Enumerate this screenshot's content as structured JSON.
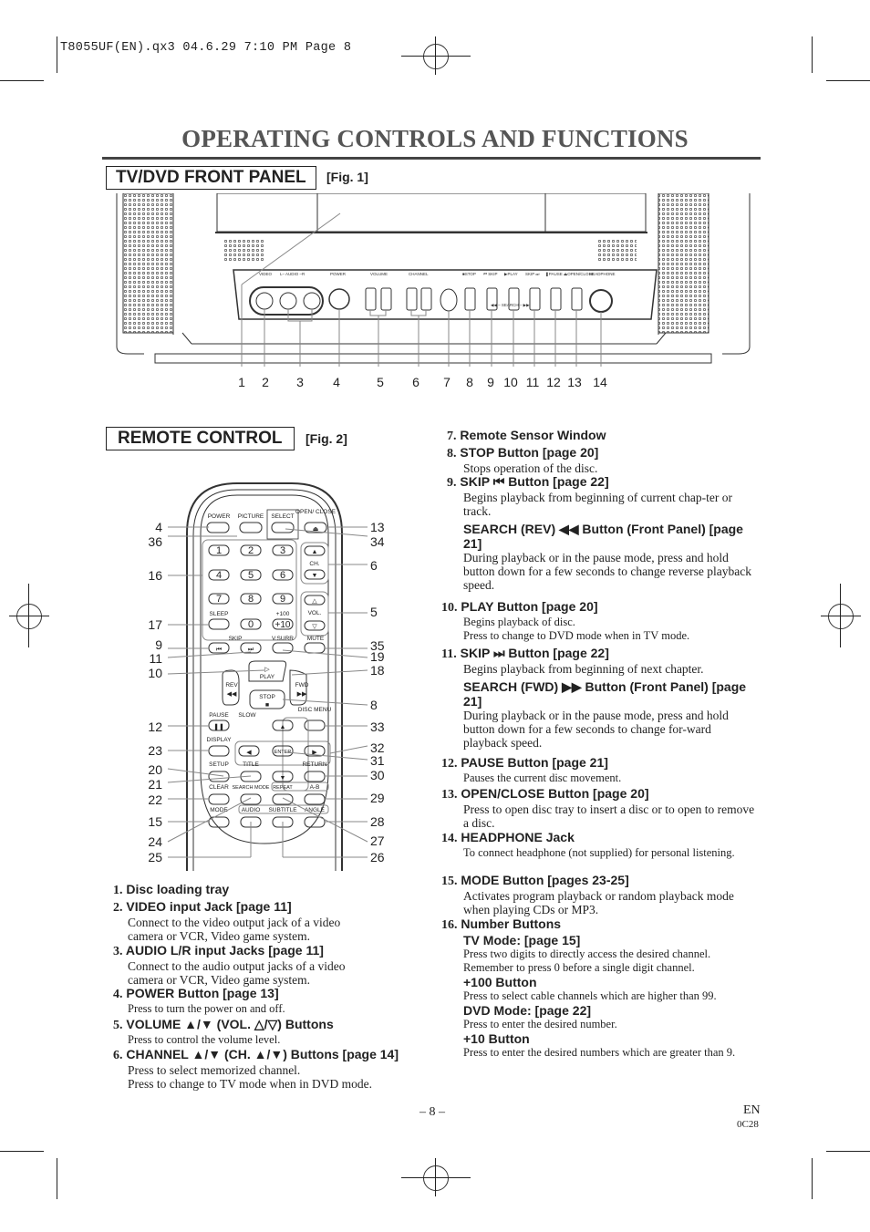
{
  "slug": "T8055UF(EN).qx3   04.6.29   7:10 PM   Page 8",
  "page_title": "OPERATING CONTROLS AND FUNCTIONS",
  "front_panel": {
    "heading": "TV/DVD FRONT PANEL",
    "fig": "[Fig. 1]",
    "labels": {
      "video": "VIDEO",
      "audio": "L– AUDIO –R",
      "power": "POWER",
      "volume": "VOLUME",
      "channel": "CHANNEL",
      "stop": "■STOP",
      "skip_rev": "⏮ SKIP",
      "play": "▶PLAY",
      "skip_fwd": "SKIP ⏭",
      "pause": "❚PAUSE",
      "open_close": "⏏OPEN/CLOSE",
      "headphone": "HEADPHONE",
      "search": "◀◀ – SEARCH – ▶▶"
    },
    "callouts": [
      "1",
      "2",
      "3",
      "4",
      "5",
      "6",
      "7",
      "8",
      "9",
      "10",
      "11",
      "12",
      "13",
      "14"
    ]
  },
  "remote": {
    "heading": "REMOTE CONTROL",
    "fig": "[Fig. 2]",
    "buttons": {
      "power": "POWER",
      "picture": "PICTURE",
      "select": "SELECT",
      "open_close": "OPEN/ CLOSE",
      "n1": "1",
      "n2": "2",
      "n3": "3",
      "n4": "4",
      "n5": "5",
      "n6": "6",
      "n7": "7",
      "n8": "8",
      "n9": "9",
      "n0": "0",
      "plus100": "+100",
      "plus10": "+10",
      "sleep": "SLEEP",
      "ch": "CH.",
      "vol": "VOL.",
      "skip": "SKIP",
      "vsurr": "V.SURR",
      "mute": "MUTE",
      "play": "PLAY",
      "rev": "REV",
      "fwd": "FWD",
      "stop": "STOP",
      "pause": "PAUSE",
      "slow": "SLOW",
      "disc_menu": "DISC MENU",
      "display": "DISPLAY",
      "enter": "ENTER",
      "setup": "SETUP",
      "title": "TITLE",
      "return": "RETURN",
      "clear": "CLEAR",
      "search_mode": "SEARCH MODE",
      "repeat": "REPEAT",
      "ab": "A-B",
      "mode": "MODE",
      "audio": "AUDIO",
      "subtitle": "SUBTITLE",
      "angle": "ANGLE"
    },
    "callouts_left": [
      "4",
      "36",
      "16",
      "17",
      "9",
      "11",
      "10",
      "12",
      "23",
      "20",
      "21",
      "22",
      "15",
      "24",
      "25"
    ],
    "callouts_right": [
      "13",
      "34",
      "6",
      "5",
      "35",
      "19",
      "18",
      "8",
      "33",
      "32",
      "31",
      "30",
      "29",
      "28",
      "27",
      "26"
    ]
  },
  "items_left": [
    {
      "num": "1.",
      "title": "Disc loading tray",
      "desc": []
    },
    {
      "num": "2.",
      "title": "VIDEO input Jack [page 11]",
      "desc": [
        "Connect to the video output jack of a video",
        "camera or VCR, Video game system."
      ]
    },
    {
      "num": "3.",
      "title": "AUDIO L/R input Jacks [page 11]",
      "desc": [
        "Connect to the audio output jacks of a video",
        "camera or VCR, Video game system."
      ]
    },
    {
      "num": "4.",
      "title": "POWER Button [page 13]",
      "desc": [
        "Press to turn the power on and off."
      ]
    },
    {
      "num": "5.",
      "title": "VOLUME ▲/▼ (VOL. △/▽) Buttons",
      "desc": [
        "Press to control the volume level."
      ]
    },
    {
      "num": "6.",
      "title": "CHANNEL ▲/▼ (CH. ▲/▼) Buttons [page 14]",
      "desc": [
        "Press to select memorized channel.",
        "Press to change to TV mode when in DVD mode."
      ]
    }
  ],
  "items_right": [
    {
      "num": "7.",
      "title": "Remote Sensor Window"
    },
    {
      "num": "8.",
      "title": "STOP Button [page 20]",
      "desc": "Stops operation of the disc."
    },
    {
      "num": "9.",
      "title": "SKIP ⏮ Button [page 22]",
      "desc": "Begins playback from beginning of current chap-ter or track.",
      "sub": "SEARCH (REV) ◀◀ Button (Front Panel) [page 21]",
      "subdesc": "During playback or in the pause mode, press and hold button down for a few seconds to change reverse playback speed."
    },
    {
      "num": "10.",
      "title": "PLAY Button [page 20]",
      "desc": "Begins playback of disc.",
      "desc2": "Press to change to DVD mode when in TV mode."
    },
    {
      "num": "11.",
      "title": "SKIP ⏭ Button [page 22]",
      "desc": "Begins playback from beginning of next chapter.",
      "sub": "SEARCH (FWD) ▶▶ Button (Front Panel) [page 21]",
      "subdesc": "During playback or in the pause mode, press and hold button down for a few seconds to change for-ward playback speed."
    },
    {
      "num": "12.",
      "title": "PAUSE Button [page 21]",
      "desc": "Pauses the current disc movement."
    },
    {
      "num": "13.",
      "title": "OPEN/CLOSE Button [page 20]",
      "desc": "Press to open disc tray to insert a disc or to open to remove a disc."
    },
    {
      "num": "14.",
      "title": "HEADPHONE Jack",
      "desc": "To connect headphone (not supplied) for personal listening."
    },
    {
      "num": "15.",
      "title": "MODE Button [pages 23-25]",
      "desc": "Activates program playback or random playback mode when playing CDs or MP3."
    },
    {
      "num": "16.",
      "title": "Number Buttons",
      "sub1": "TV Mode: [page 15]",
      "d1": "Press two digits to directly access the desired channel. Remember to press 0 before a single digit channel.",
      "sub2": "+100 Button",
      "d2": "Press to select cable channels which are higher than 99.",
      "sub3": "DVD Mode: [page 22]",
      "d3": "Press to enter the desired number.",
      "sub4": "+10 Button",
      "d4": "Press to enter the desired numbers which are greater than 9."
    }
  ],
  "footer": {
    "page": "– 8 –",
    "lang": "EN",
    "code": "0C28"
  }
}
